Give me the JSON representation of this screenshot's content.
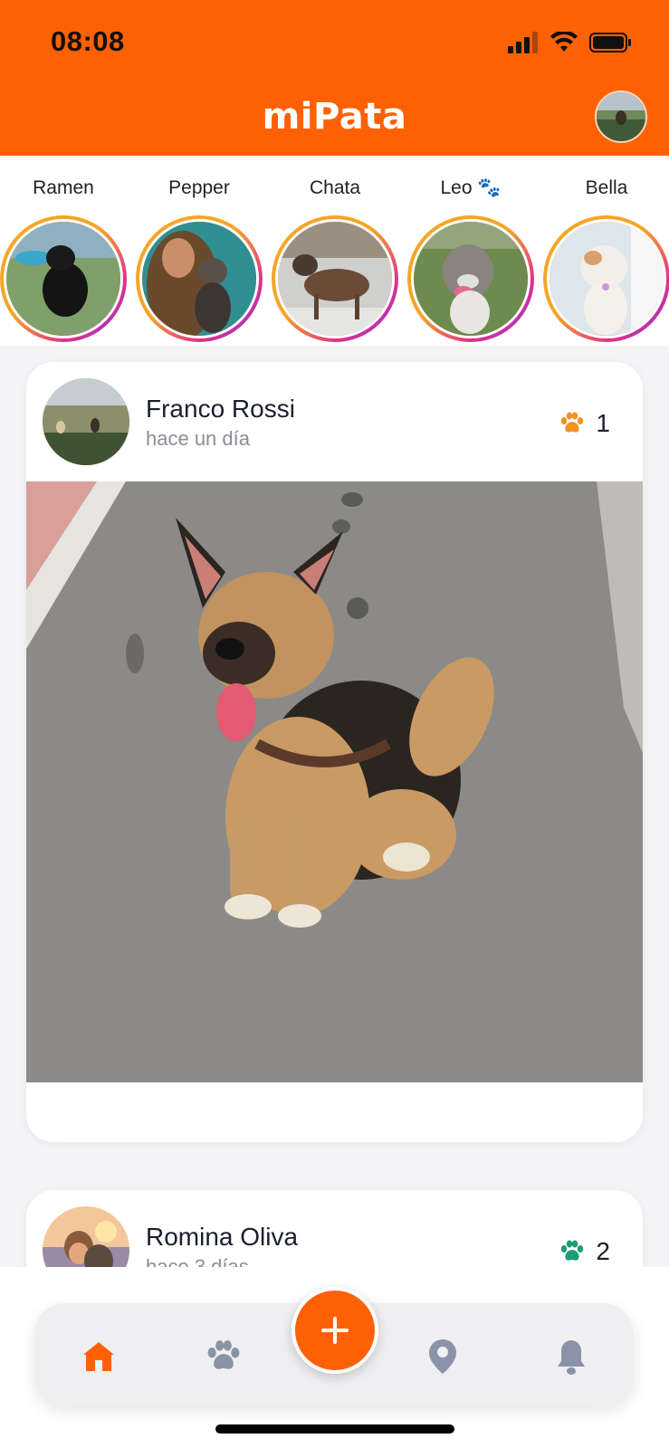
{
  "status_bar": {
    "time": "08:08"
  },
  "app": {
    "title": "miPata"
  },
  "stories": [
    {
      "name": "Ramen"
    },
    {
      "name": "Pepper"
    },
    {
      "name": "Chata"
    },
    {
      "name": "Leo 🐾"
    },
    {
      "name": "Bella"
    }
  ],
  "posts": [
    {
      "author": "Franco Rossi",
      "time": "hace un día",
      "paw_count": "1",
      "paw_color": "#f39223"
    },
    {
      "author": "Romina Oliva",
      "time": "hace 3 días",
      "paw_count": "2",
      "paw_color": "#1c9c77"
    }
  ],
  "nav": {
    "items": [
      "home-icon",
      "paw-icon",
      "add-icon",
      "location-icon",
      "bell-icon"
    ],
    "active_color": "#fe6104",
    "inactive_color": "#8a93a8"
  },
  "colors": {
    "brand": "#fe6104"
  }
}
